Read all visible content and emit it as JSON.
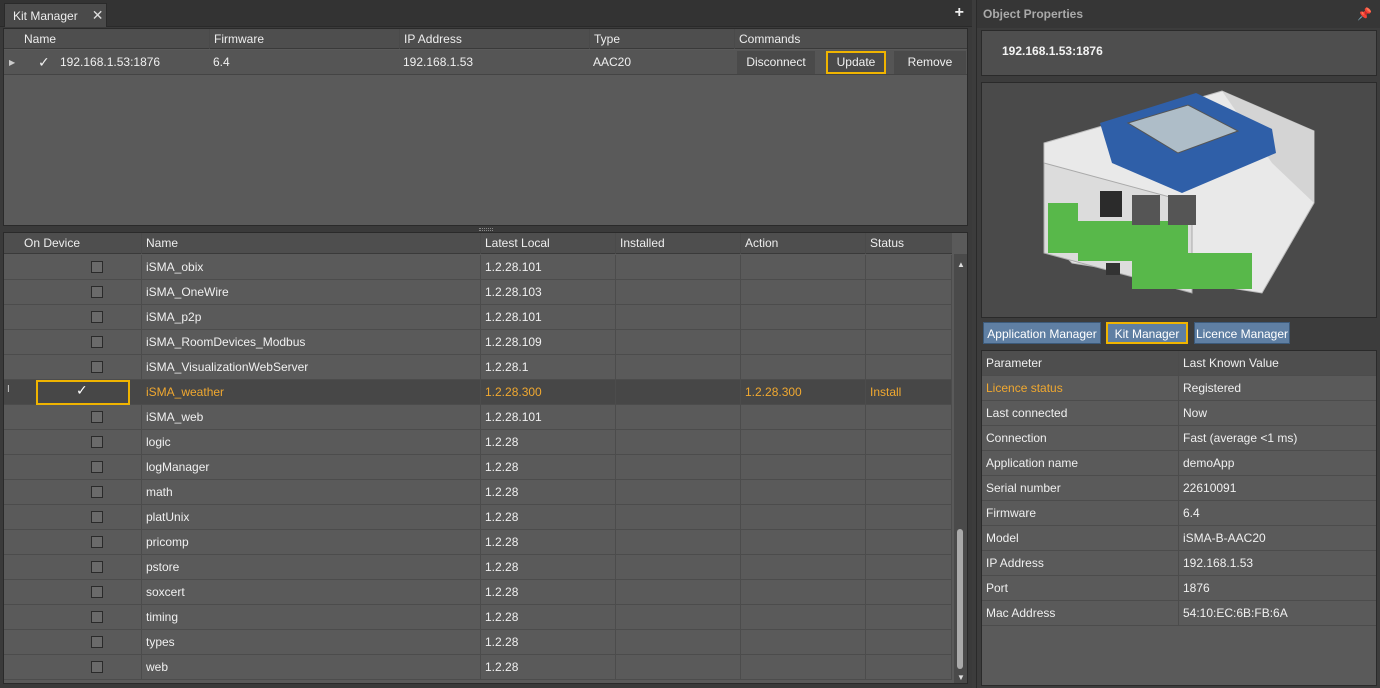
{
  "tab": {
    "title": "Kit Manager",
    "close": "✕",
    "add": "+"
  },
  "devices": {
    "columns": [
      "Name",
      "Firmware",
      "IP Address",
      "Type",
      "Commands"
    ],
    "row": {
      "name": "192.168.1.53:1876",
      "firmware": "6.4",
      "ip": "192.168.1.53",
      "type": "AAC20",
      "disconnect": "Disconnect",
      "update": "Update",
      "remove": "Remove"
    }
  },
  "kits": {
    "columns": [
      "On Device",
      "Name",
      "Latest Local",
      "Installed",
      "Action",
      "Status"
    ],
    "rows": [
      {
        "on": false,
        "name": "iSMA_obix",
        "latest": "1.2.28.101",
        "installed": "",
        "action": "",
        "status": ""
      },
      {
        "on": false,
        "name": "iSMA_OneWire",
        "latest": "1.2.28.103",
        "installed": "",
        "action": "",
        "status": ""
      },
      {
        "on": false,
        "name": "iSMA_p2p",
        "latest": "1.2.28.101",
        "installed": "",
        "action": "",
        "status": ""
      },
      {
        "on": false,
        "name": "iSMA_RoomDevices_Modbus",
        "latest": "1.2.28.109",
        "installed": "",
        "action": "",
        "status": ""
      },
      {
        "on": false,
        "name": "iSMA_VisualizationWebServer",
        "latest": "1.2.28.1",
        "installed": "",
        "action": "",
        "status": ""
      },
      {
        "on": true,
        "name": "iSMA_weather",
        "latest": "1.2.28.300",
        "installed": "",
        "action": "1.2.28.300",
        "status": "Install"
      },
      {
        "on": false,
        "name": "iSMA_web",
        "latest": "1.2.28.101",
        "installed": "",
        "action": "",
        "status": ""
      },
      {
        "on": false,
        "name": "logic",
        "latest": "1.2.28",
        "installed": "",
        "action": "",
        "status": ""
      },
      {
        "on": false,
        "name": "logManager",
        "latest": "1.2.28",
        "installed": "",
        "action": "",
        "status": ""
      },
      {
        "on": false,
        "name": "math",
        "latest": "1.2.28",
        "installed": "",
        "action": "",
        "status": ""
      },
      {
        "on": false,
        "name": "platUnix",
        "latest": "1.2.28",
        "installed": "",
        "action": "",
        "status": ""
      },
      {
        "on": false,
        "name": "pricomp",
        "latest": "1.2.28",
        "installed": "",
        "action": "",
        "status": ""
      },
      {
        "on": false,
        "name": "pstore",
        "latest": "1.2.28",
        "installed": "",
        "action": "",
        "status": ""
      },
      {
        "on": false,
        "name": "soxcert",
        "latest": "1.2.28",
        "installed": "",
        "action": "",
        "status": ""
      },
      {
        "on": false,
        "name": "timing",
        "latest": "1.2.28",
        "installed": "",
        "action": "",
        "status": ""
      },
      {
        "on": false,
        "name": "types",
        "latest": "1.2.28",
        "installed": "",
        "action": "",
        "status": ""
      },
      {
        "on": false,
        "name": "web",
        "latest": "1.2.28",
        "installed": "",
        "action": "",
        "status": ""
      }
    ]
  },
  "properties": {
    "title": "Object Properties",
    "object_name": "192.168.1.53:1876",
    "nav": [
      "Application Manager",
      "Kit Manager",
      "Licence Manager"
    ],
    "header": {
      "key": "Parameter",
      "value": "Last Known Value"
    },
    "rows": [
      {
        "key": "Licence status",
        "value": "Registered"
      },
      {
        "key": "Last connected",
        "value": "Now"
      },
      {
        "key": "Connection",
        "value": "Fast (average <1 ms)"
      },
      {
        "key": "Application name",
        "value": "demoApp"
      },
      {
        "key": "Serial number",
        "value": "22610091"
      },
      {
        "key": "Firmware",
        "value": "6.4"
      },
      {
        "key": "Model",
        "value": "iSMA-B-AAC20"
      },
      {
        "key": "IP Address",
        "value": "192.168.1.53"
      },
      {
        "key": "Port",
        "value": "1876"
      },
      {
        "key": "Mac Address",
        "value": "54:10:EC:6B:FB:6A"
      }
    ]
  },
  "colors": {
    "highlight": "#f0b400",
    "accent": "#f0a830",
    "nav_button": "#5f7fa3"
  }
}
